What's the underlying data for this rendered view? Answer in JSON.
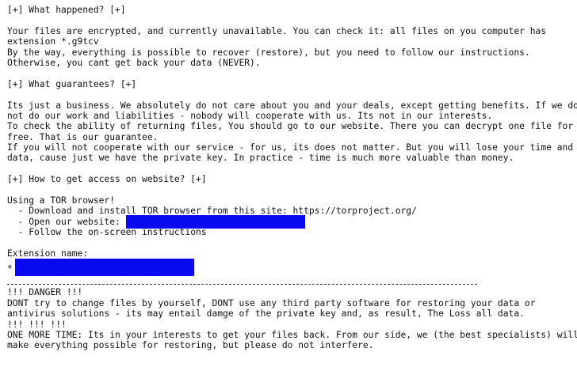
{
  "note": {
    "what_happened_heading": "[+] What happened? [+]",
    "what_happened_lines": [
      "Your files are encrypted, and currently unavailable. You can check it: all files on you computer has",
      "extension *.g9tcv",
      "By the way, everything is possible to recover (restore), but you need to follow our instructions.",
      "Otherwise, you cant get back your data (NEVER)."
    ],
    "guarantees_heading": "[+] What guarantees? [+]",
    "guarantees_lines": [
      "Its just a business. We absolutely do not care about you and your deals, except getting benefits. If we do",
      "not do our work and liabilities - nobody will cooperate with us. Its not in our interests.",
      "To check the ability of returning files, You should go to our website. There you can decrypt one file for",
      "free. That is our guarantee.",
      "If you will not cooperate with our service - for us, its does not matter. But you will lose your time and",
      "data, cause just we have the private key. In practice - time is much more valuable than money."
    ],
    "access_heading": "[+] How to get access on website? [+]",
    "access_intro": "Using a TOR browser!",
    "access_steps": [
      "  - Download and install TOR browser from this site: https://torproject.org/",
      "  - Open our website: ",
      "  - Follow the on-screen instructions"
    ],
    "extension_label": "Extension name:",
    "extension_prefix": "*",
    "danger_heading": "!!! DANGER !!!",
    "danger_lines": [
      "DONT try to change files by yourself, DONT use any third party software for restoring your data or",
      "antivirus solutions - its may entail damge of the private key and, as result, The Loss all data.",
      "!!! !!! !!!",
      "ONE MORE TIME: Its in your interests to get your files back. From our side, we (the best specialists) will",
      "make everything possible for restoring, but please do not interfere."
    ]
  },
  "colors": {
    "redaction": "#0a0af0",
    "text": "#111111",
    "background": "#ffffff"
  }
}
